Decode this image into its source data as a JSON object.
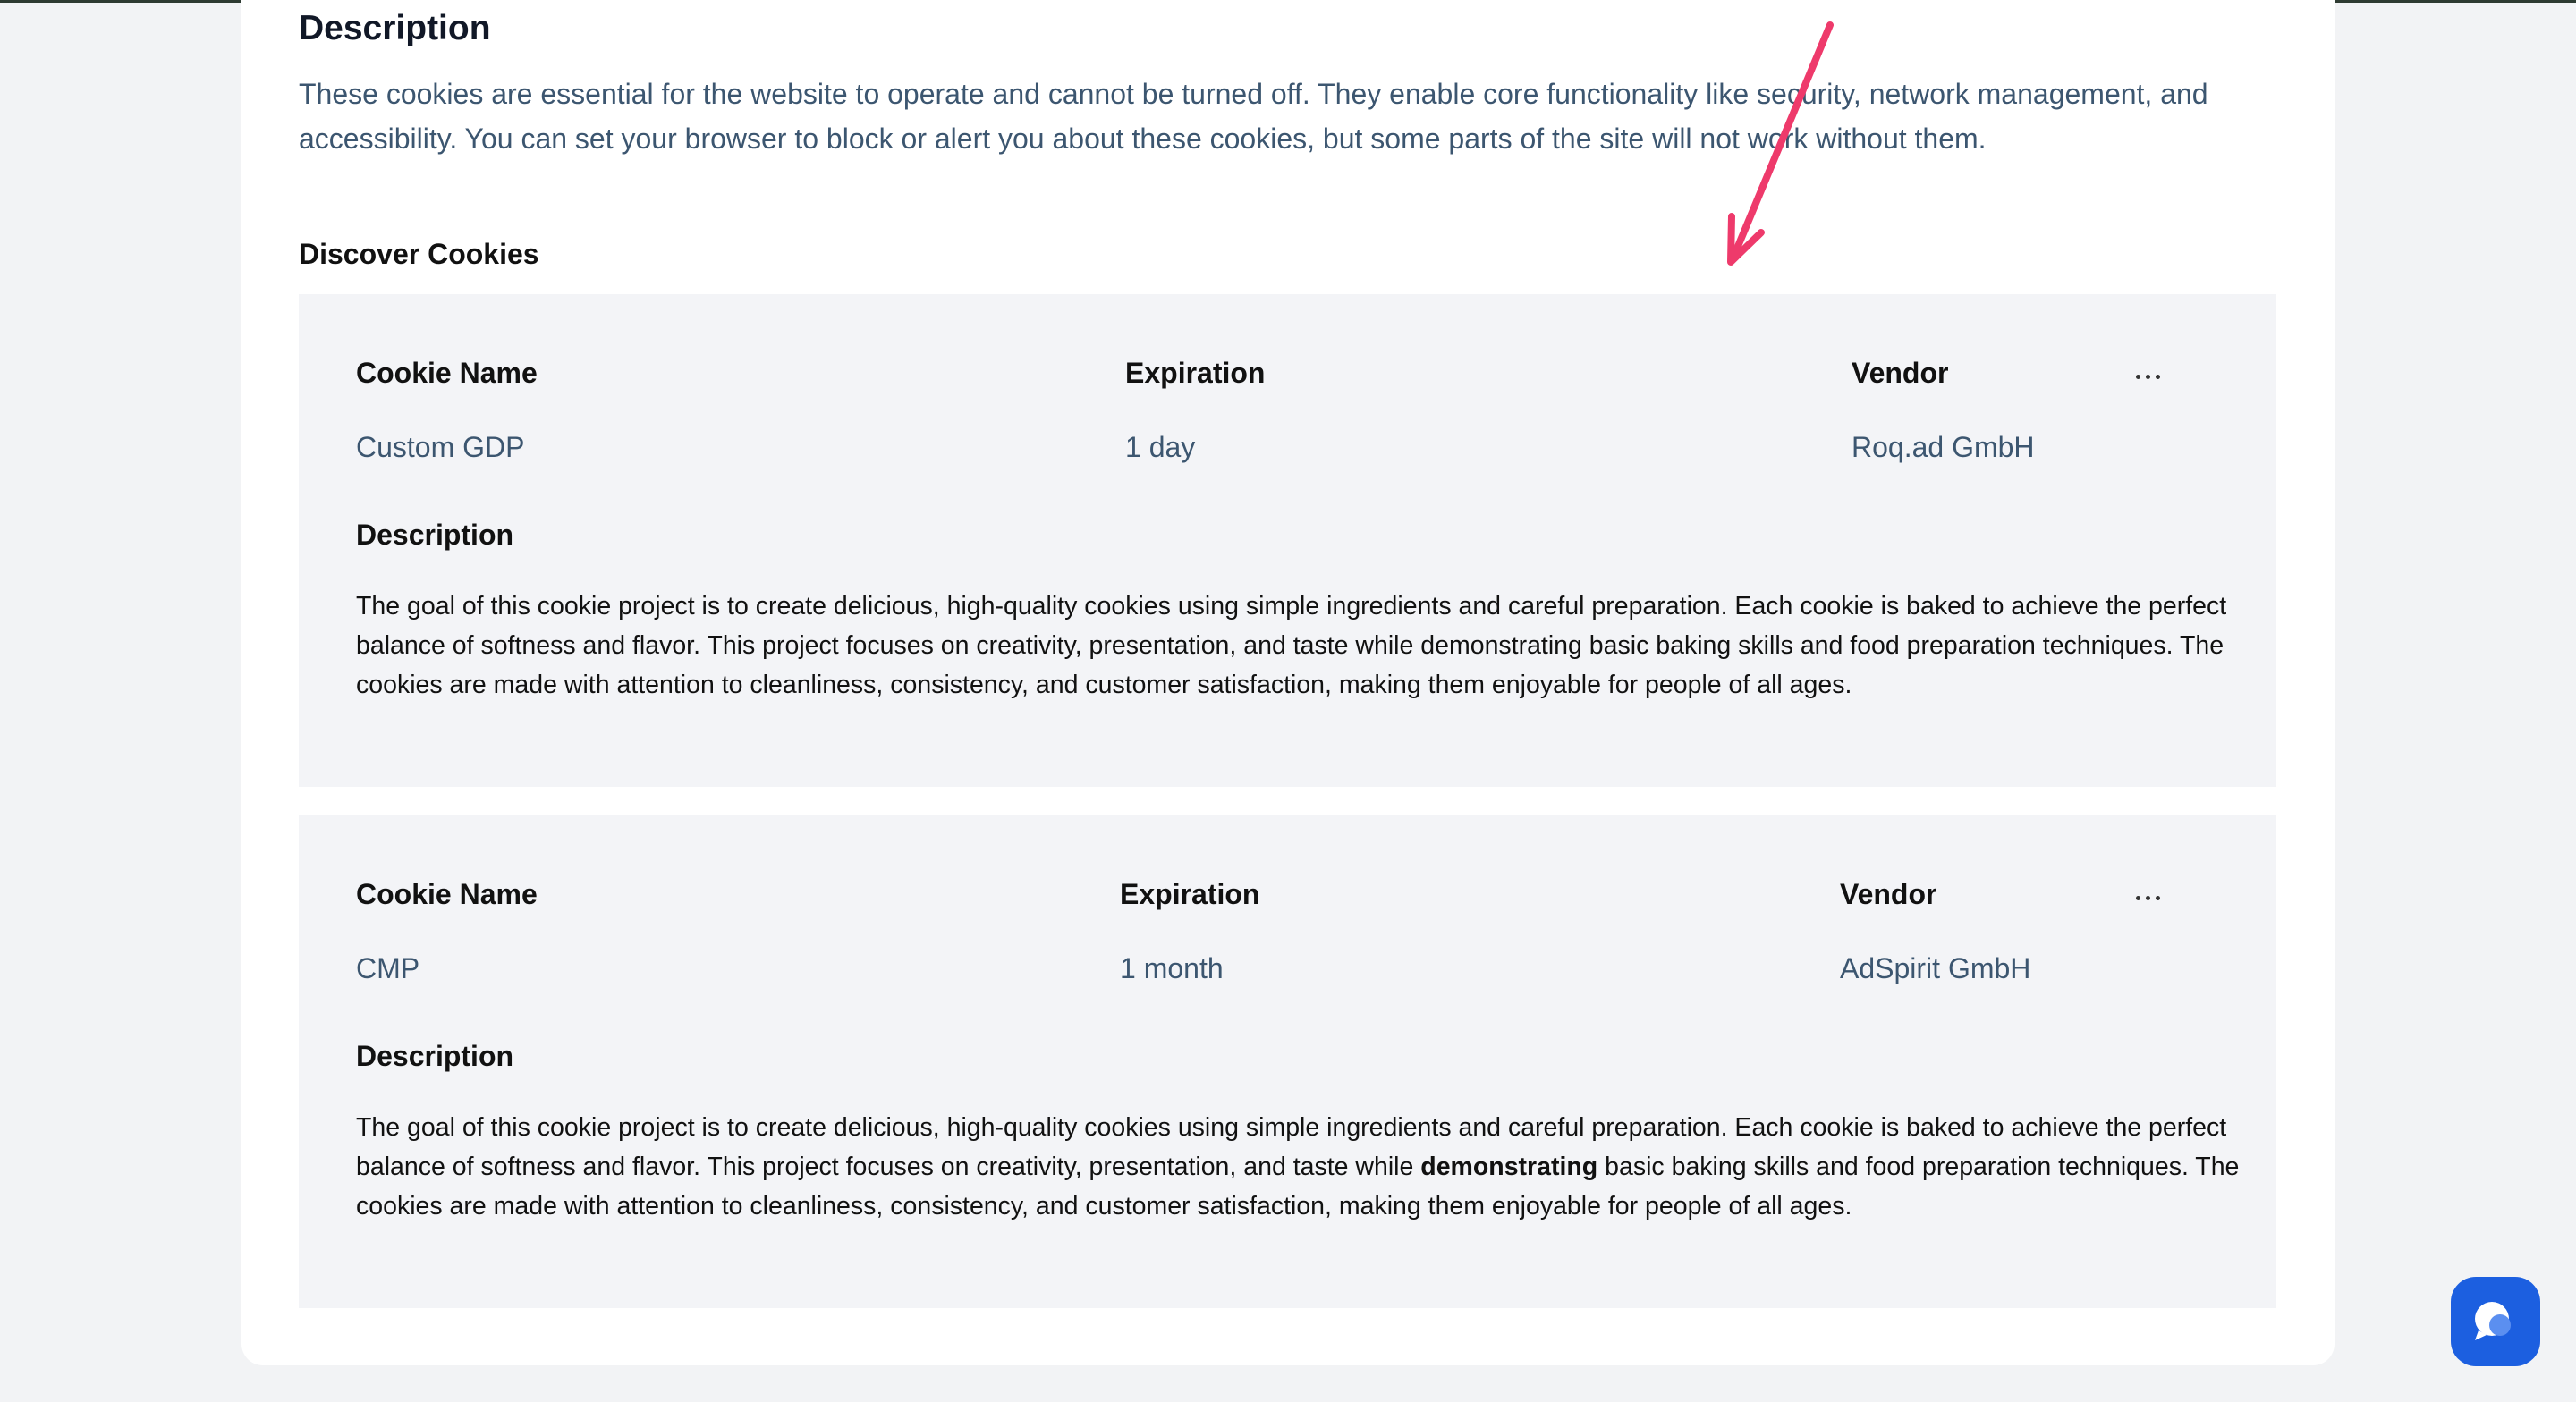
{
  "section": {
    "title": "Description",
    "description": "These cookies are essential for the website to operate and cannot be turned off. They enable core functionality like security, network management, and accessibility. You can set your browser to block or alert you about these cookies, but some parts of the site will not work without them."
  },
  "discover": {
    "title": "Discover Cookies"
  },
  "cookies": [
    {
      "name_header": "Cookie Name",
      "name": "Custom GDP",
      "expiration_header": "Expiration",
      "expiration": "1 day",
      "vendor_header": "Vendor",
      "vendor": "Roq.ad GmbH",
      "description_header": "Description",
      "description": "The goal of this cookie project is to create delicious, high-quality cookies using simple ingredients and careful preparation. Each cookie is baked to achieve the perfect balance of softness and flavor. This project focuses on creativity, presentation, and taste while demonstrating basic baking skills and food preparation techniques. The cookies are made with attention to cleanliness, consistency, and customer satisfaction, making them enjoyable for people of all ages."
    },
    {
      "name_header": "Cookie Name",
      "name": "CMP",
      "expiration_header": "Expiration",
      "expiration": "1 month",
      "vendor_header": "Vendor",
      "vendor": "AdSpirit GmbH",
      "description_header": "Description",
      "description_before": "The goal of this cookie project is to create delicious, high-quality cookies using simple ingredients and careful preparation. Each cookie is baked to achieve the perfect balance of softness and flavor. This project focuses on creativity, presentation, and taste while ",
      "description_bold": "demonstrating",
      "description_after": " basic baking skills and food preparation techniques. The cookies are made with attention to cleanliness, consistency, and customer satisfaction, making them enjoyable for people of all ages."
    }
  ],
  "icons": {
    "more": "more-horizontal-icon",
    "annotation": "annotation-arrow-icon",
    "chat": "chat-bubble-icon"
  },
  "colors": {
    "annotation_arrow": "#ee3a6b",
    "chat_button": "#1c5fe0",
    "body_text": "#3c5670"
  }
}
